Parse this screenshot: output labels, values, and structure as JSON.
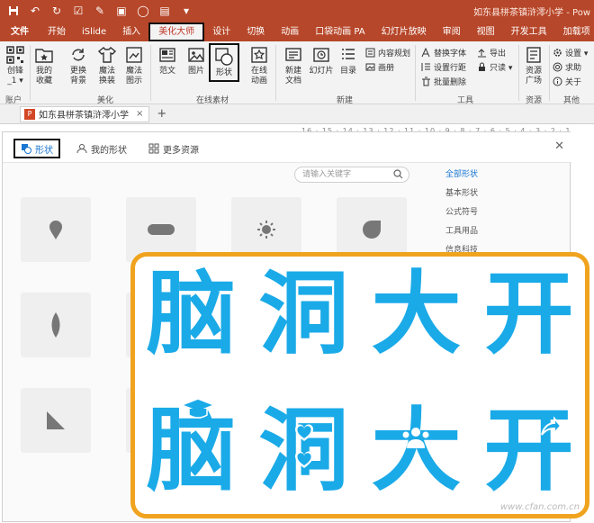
{
  "window": {
    "title": "如东县栟茶镇浒澪小学 - Pow"
  },
  "tabs": [
    "文件",
    "开始",
    "iSlide",
    "插入",
    "美化大师",
    "设计",
    "切换",
    "动画",
    "口袋动画 PA",
    "幻灯片放映",
    "审阅",
    "视图",
    "开发工具",
    "加载项"
  ],
  "ribbon": {
    "account": {
      "label1": "创锋",
      "label2": "_1 ▾",
      "group": "账户"
    },
    "beautify": {
      "items": [
        {
          "l1": "我的",
          "l2": "收藏"
        },
        {
          "l1": "更换",
          "l2": "背景"
        },
        {
          "l1": "魔法",
          "l2": "换装"
        },
        {
          "l1": "魔法",
          "l2": "图示"
        }
      ],
      "group": "美化"
    },
    "online": {
      "items": [
        {
          "l1": "范文",
          "l2": ""
        },
        {
          "l1": "图片",
          "l2": ""
        },
        {
          "l1": "形状",
          "l2": ""
        },
        {
          "l1": "在线",
          "l2": "动画"
        }
      ],
      "group": "在线素材"
    },
    "new": {
      "items": [
        {
          "l1": "新建",
          "l2": "文档"
        },
        {
          "l1": "幻灯片",
          "l2": ""
        },
        {
          "l1": "目录",
          "l2": ""
        }
      ],
      "small": [
        "内容规划",
        "画册"
      ],
      "group": "新建"
    },
    "tools": {
      "small": [
        "替换字体",
        "导出",
        "设置行距",
        "只读 ▾",
        "批量删除"
      ],
      "group": "工具"
    },
    "resources": {
      "l1": "资源",
      "l2": "广场",
      "group": "资源"
    },
    "other": {
      "small": [
        "设置 ▾",
        "求助",
        "关于"
      ],
      "group": "其他"
    }
  },
  "doc": {
    "tab_title": "如东县栟茶镇浒澪小学",
    "close": "×",
    "add": "+",
    "ruler": "16 · 15 · 14 · 13 · 12 · 11 · 10 · 9 · 8 · 7 · 6 · 5 · 4 · 3 · 2 · 1"
  },
  "panel": {
    "tabs": [
      "形状",
      "我的形状",
      "更多资源"
    ],
    "search_placeholder": "请输入关键字",
    "categories": [
      "全部形状",
      "基本形状",
      "公式符号",
      "工具用品",
      "信息科技"
    ]
  },
  "overlay": {
    "row1": [
      "脑",
      "洞",
      "大",
      "开"
    ],
    "row2": [
      "脑",
      "洞",
      "大",
      "开"
    ]
  },
  "watermark": "www.cfan.com.cn",
  "colors": {
    "accent": "#b7472a",
    "big_text": "#1aaae8",
    "frame": "#f0a31e",
    "link": "#1976d2"
  }
}
